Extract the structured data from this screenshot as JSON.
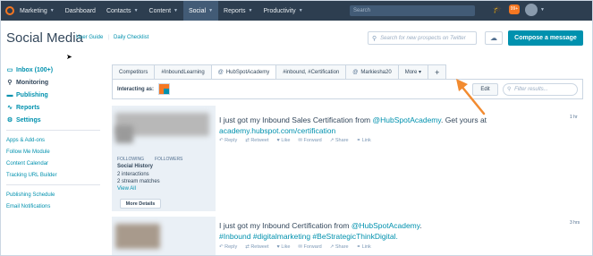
{
  "nav": {
    "items": [
      {
        "label": "Marketing",
        "caret": true,
        "active": false
      },
      {
        "label": "Dashboard",
        "caret": false,
        "active": false
      },
      {
        "label": "Contacts",
        "caret": true,
        "active": false
      },
      {
        "label": "Content",
        "caret": true,
        "active": false
      },
      {
        "label": "Social",
        "caret": true,
        "active": true
      },
      {
        "label": "Reports",
        "caret": true,
        "active": false
      },
      {
        "label": "Productivity",
        "caret": true,
        "active": false
      }
    ],
    "search_placeholder": "Search",
    "notification_count": "99+"
  },
  "header": {
    "title": "Social Media",
    "user_guide": "User Guide",
    "separator": "|",
    "daily_checklist": "Daily Checklist",
    "prospect_placeholder": "Search for new prospects on Twitter",
    "compose_label": "Compose a message"
  },
  "sidebar": {
    "main": [
      {
        "label": "Inbox (100+)",
        "icon": "inbox-icon",
        "glyph": "▭"
      },
      {
        "label": "Monitoring",
        "icon": "search-icon",
        "glyph": "⚲"
      },
      {
        "label": "Publishing",
        "icon": "chat-icon",
        "glyph": "▬"
      },
      {
        "label": "Reports",
        "icon": "pulse-icon",
        "glyph": "∿"
      },
      {
        "label": "Settings",
        "icon": "gear-icon",
        "glyph": "⚙"
      }
    ],
    "links_a": [
      "Apps & Add-ons",
      "Follow Me Module",
      "Content Calendar",
      "Tracking URL Builder"
    ],
    "links_b": [
      "Publishing Schedule",
      "Email Notifications"
    ]
  },
  "tabs": [
    {
      "label": "Competitors",
      "at": false,
      "active": false
    },
    {
      "label": "#InboundLearning",
      "at": false,
      "active": false
    },
    {
      "label": "HubSpotAcademy",
      "at": true,
      "active": true
    },
    {
      "label": "#inbound, #Certification",
      "at": false,
      "active": false
    },
    {
      "label": "Markiesha20",
      "at": true,
      "active": false
    },
    {
      "label": "More ▾",
      "at": false,
      "active": false
    },
    {
      "label": "+",
      "at": false,
      "active": false
    }
  ],
  "toolbar": {
    "interacting_as": "Interacting as:",
    "edit_label": "Edit",
    "filter_placeholder": "Filter results..."
  },
  "stream": [
    {
      "profile": {
        "followers_a": "FOLLOWING",
        "followers_b": "FOLLOWERS",
        "social_history": "Social History",
        "interactions": "2 interactions",
        "matches": "2 stream matches",
        "view_all": "View All",
        "more_details": "More Details"
      },
      "text_pre": "I just got my Inbound Sales Certification from ",
      "mention": "@HubSpotAcademy",
      "text_mid": ". Get yours at ",
      "link": "academy.hubspot.com/certification",
      "time": "1 hr"
    },
    {
      "text_pre": "I just got my Inbound Certification from ",
      "mention": "@HubSpotAcademy",
      "text_mid": ".",
      "hashtags": " #Inbound #digitalmarketing #BeStrategicThinkDigital.",
      "time": "3 hrs"
    }
  ],
  "actions": [
    "↶ Reply",
    "⇄ Retweet",
    "♥ Like",
    "✉ Forward",
    "↗ Share",
    "⚭ Link"
  ]
}
